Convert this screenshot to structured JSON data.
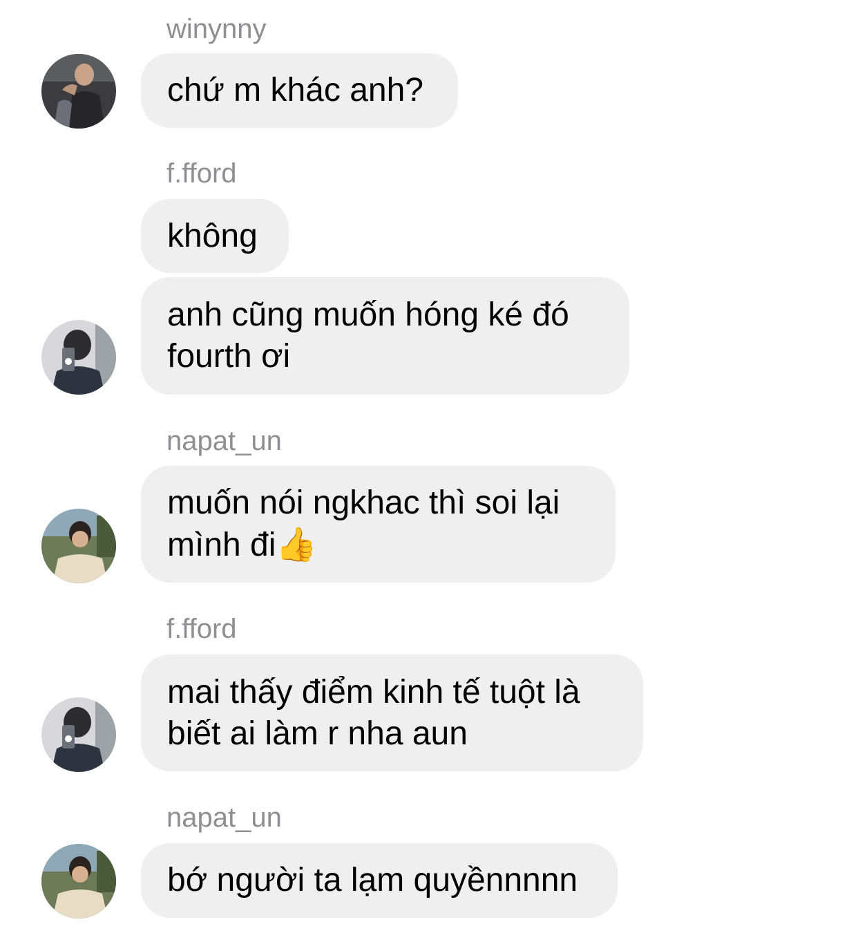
{
  "messages": [
    {
      "username": "winynny",
      "lines": [
        "chứ m khác anh?"
      ]
    },
    {
      "username": "f.fford",
      "lines": [
        "không"
      ]
    },
    {
      "username": "",
      "lines": [
        "anh cũng muốn hóng ké đó",
        "fourth ơi"
      ]
    },
    {
      "username": "napat_un",
      "lines": [
        "muốn nói ngkhac thì soi lại",
        "mình đi"
      ],
      "emoji": "👍"
    },
    {
      "username": "f.fford",
      "lines": [
        "mai thấy điểm kinh tế tuột là",
        "biết ai làm r nha aun"
      ]
    },
    {
      "username": "napat_un",
      "lines": [
        "bớ người ta lạm quyềnnnnn"
      ]
    }
  ],
  "colors": {
    "bubble": "#efefef",
    "username": "#8e8e93",
    "text": "#000000"
  }
}
